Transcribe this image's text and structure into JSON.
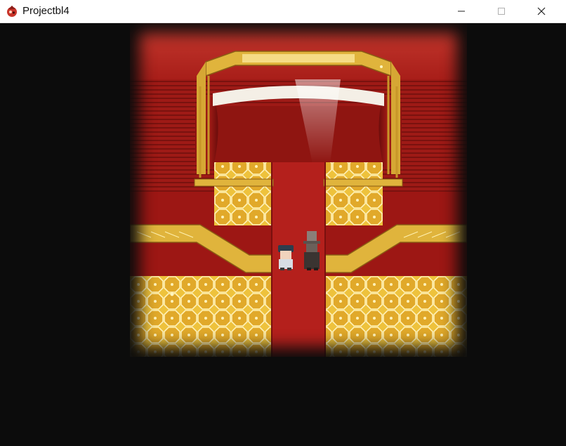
{
  "window": {
    "title": "Projectbl4",
    "controls": {
      "minimize_icon": "minimize-icon",
      "maximize_icon": "maximize-icon",
      "close_icon": "close-icon"
    }
  },
  "game": {
    "scene": "theater-lobby",
    "characters": [
      "hero-sprite",
      "top-hat-npc-sprite"
    ],
    "colors": {
      "carpet": "#b4201c",
      "wall": "#a61b17",
      "gold": "#e3b63a",
      "floor_pattern": "#f0c842",
      "background": "#0c0c0c"
    }
  }
}
